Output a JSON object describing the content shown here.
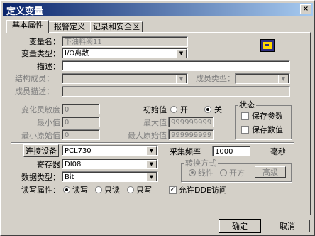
{
  "window": {
    "title": "定义变量",
    "close_label": "×"
  },
  "tabs": [
    "基本属性",
    "报警定义",
    "记录和安全区"
  ],
  "form": {
    "var_name_label": "变量名：",
    "var_name_value": "下油料阀11",
    "var_type_label": "变量类型：",
    "var_type_value": "I/O离散",
    "desc_label": "描述：",
    "desc_value": "",
    "struct_member_label": "结构成员：",
    "member_type_label": "成员类型：",
    "member_desc_label": "成员描述：",
    "sensitivity_label": "变化灵敏度",
    "sensitivity_value": "0",
    "min_label": "最小值",
    "min_value": "0",
    "min_raw_label": "最小原始值",
    "min_raw_value": "0",
    "initial_label": "初始值",
    "on_label": "开",
    "off_label": "关",
    "max_label": "最大值",
    "max_value": "999999999",
    "max_raw_label": "最大原始值",
    "max_raw_value": "999999999",
    "status_group": "状态",
    "save_param_label": "保存参数",
    "save_value_label": "保存数值",
    "connect_button": "连接设备",
    "device_value": "PCL730",
    "register_label": "寄存器",
    "register_value": "DI08",
    "datatype_label": "数据类型：",
    "datatype_value": "Bit",
    "rw_label": "读写属性：",
    "rw_readwrite": "读写",
    "rw_readonly": "只读",
    "rw_writeonly": "只写",
    "sample_freq_label": "采集频率",
    "sample_freq_value": "1000",
    "ms_label": "毫秒",
    "convert_group": "转换方式",
    "linear_label": "线性",
    "sqrt_label": "开方",
    "advanced_button": "高级",
    "dde_label": "允许DDE访问",
    "dde_checked": "✓"
  },
  "buttons": {
    "ok": "确定",
    "cancel": "取消"
  }
}
